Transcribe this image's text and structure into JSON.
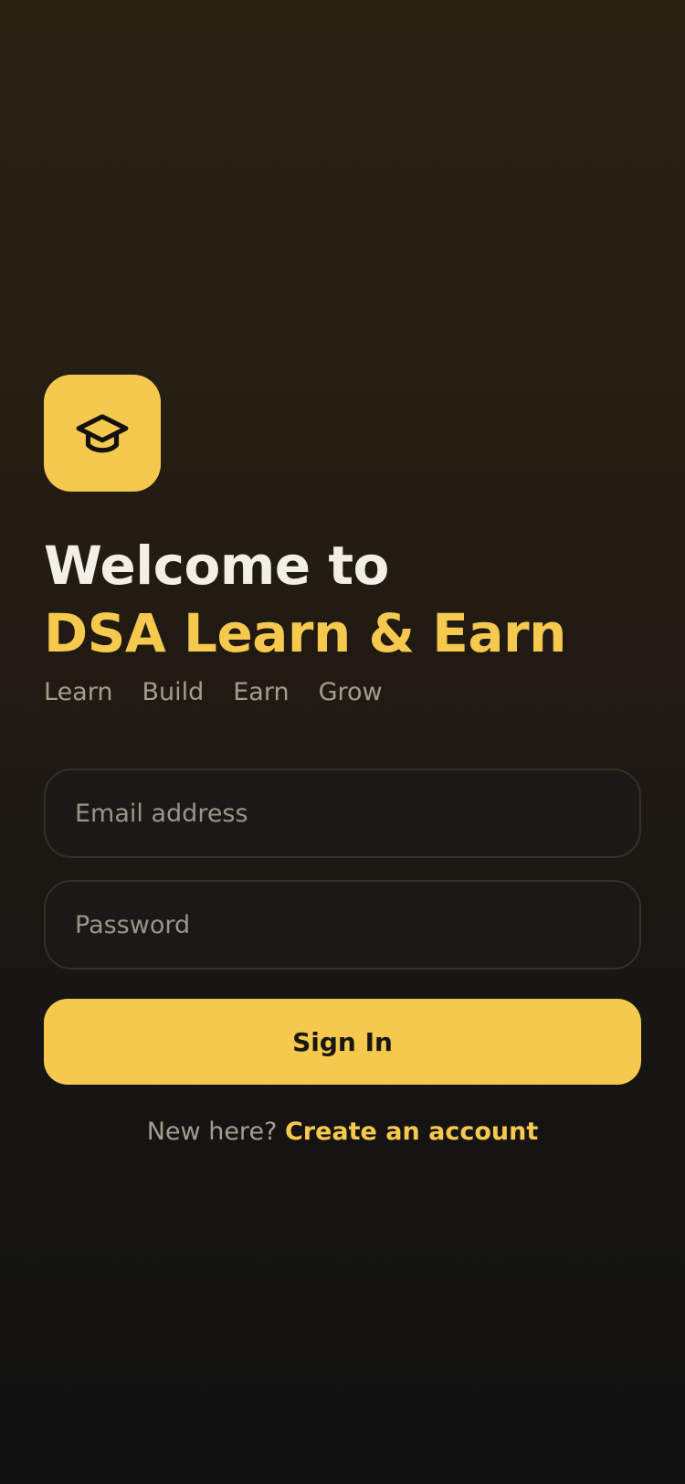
{
  "app": {
    "logo_icon": "graduation-cap-icon",
    "accent_color": "#f5c94e",
    "background_color": "#121212"
  },
  "header": {
    "welcome": "Welcome to",
    "app_name": "DSA Learn & Earn",
    "tagline": [
      "Learn",
      "Build",
      "Earn",
      "Grow"
    ]
  },
  "form": {
    "email_placeholder": "Email address",
    "email_value": "",
    "password_placeholder": "Password",
    "password_value": "",
    "signin_label": "Sign In"
  },
  "footer": {
    "prompt": "New here?",
    "link_label": "Create an account"
  }
}
